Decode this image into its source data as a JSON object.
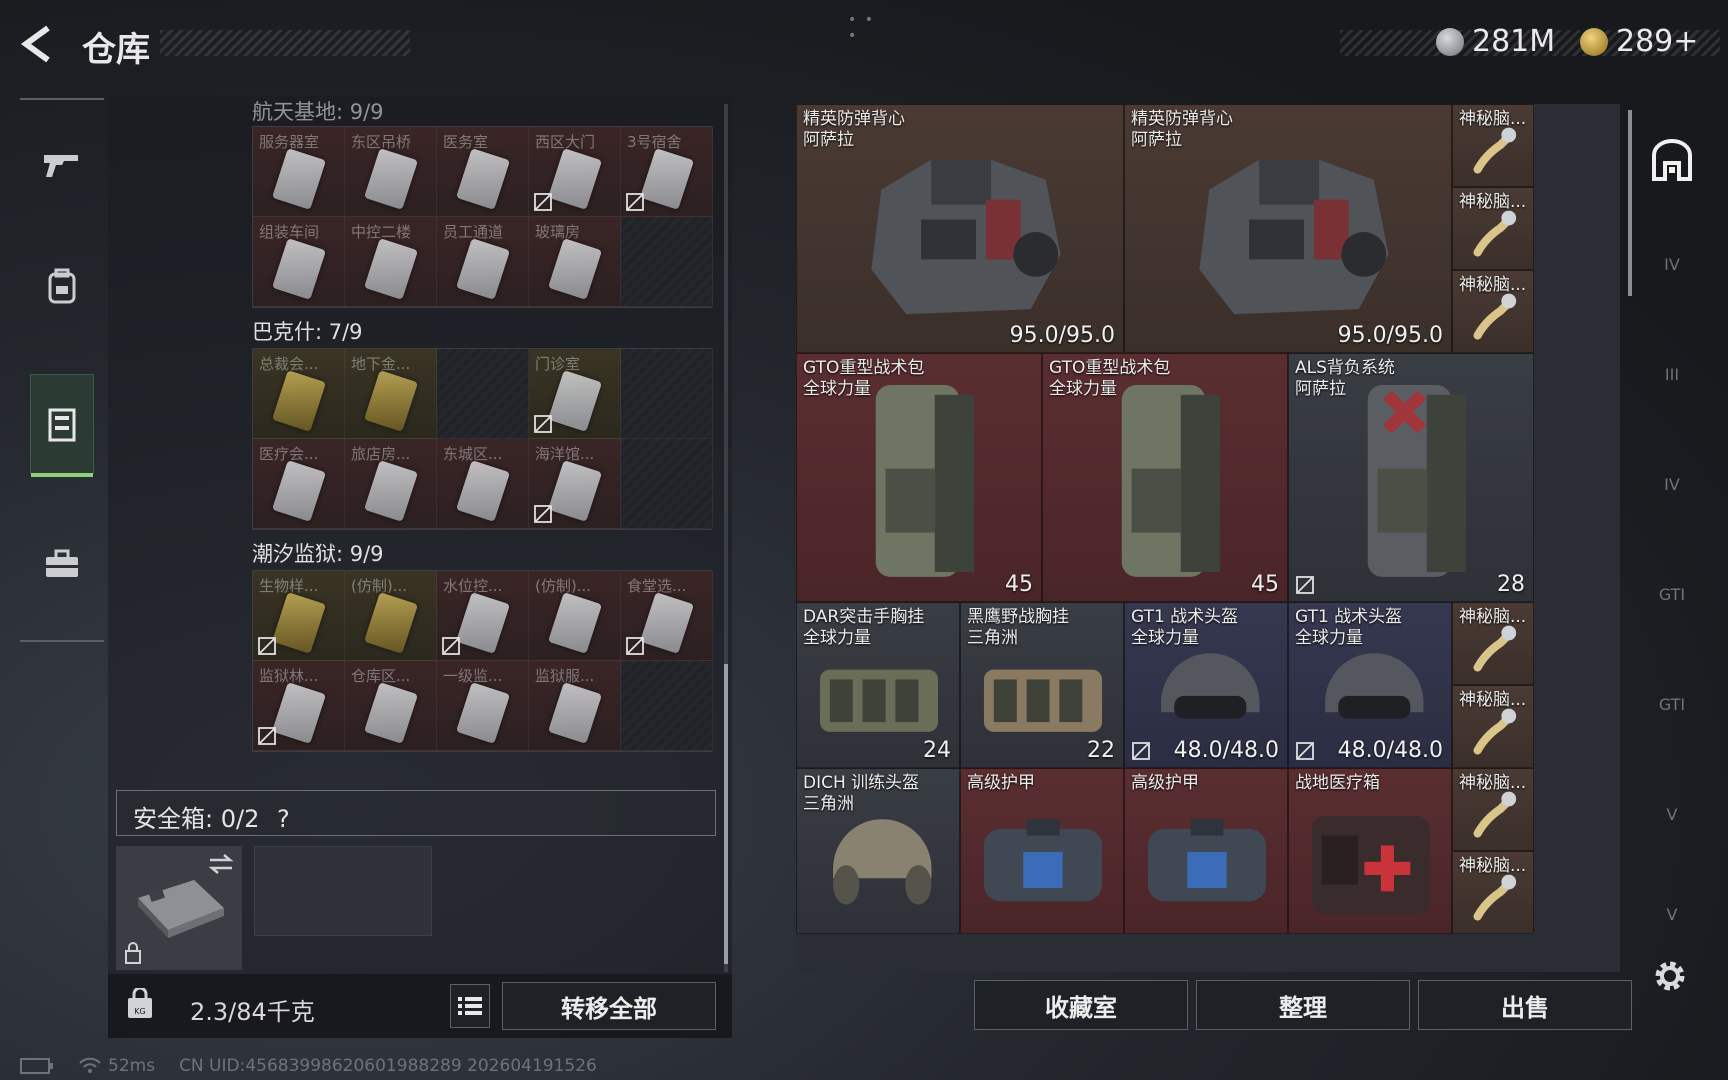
{
  "header": {
    "title": "仓库",
    "currency_silver": "281M",
    "currency_gold": "289+"
  },
  "left_rail": {
    "items": [
      "gun-icon",
      "backpack-icon",
      "locker-icon",
      "briefcase-icon"
    ],
    "active": "locker-icon"
  },
  "keys": {
    "top_map_label": "航天基地: 9/9",
    "top_cards": [
      {
        "name": "服务器室",
        "tint": "red",
        "nodrop": false
      },
      {
        "name": "东区吊桥",
        "tint": "red",
        "nodrop": false
      },
      {
        "name": "医务室",
        "tint": "red",
        "nodrop": false
      },
      {
        "name": "西区大门",
        "tint": "red",
        "nodrop": true
      },
      {
        "name": "3号宿舍",
        "tint": "red",
        "nodrop": true
      },
      {
        "name": "组装车间",
        "tint": "red",
        "nodrop": false
      },
      {
        "name": "中控二楼",
        "tint": "red",
        "nodrop": false
      },
      {
        "name": "员工通道",
        "tint": "red",
        "nodrop": false
      },
      {
        "name": "玻璃房",
        "tint": "red",
        "nodrop": false
      },
      {
        "name": "",
        "tint": "empty",
        "nodrop": false
      }
    ],
    "bakshi_label": "巴克什: 7/9",
    "bakshi_cards": [
      {
        "name": "总裁会...",
        "tint": "yellow",
        "gold": true,
        "nodrop": false
      },
      {
        "name": "地下金...",
        "tint": "yellow",
        "gold": true,
        "nodrop": false
      },
      {
        "name": "",
        "tint": "empty",
        "nodrop": false
      },
      {
        "name": "门诊室",
        "tint": "yellow",
        "nodrop": true
      },
      {
        "name": "",
        "tint": "empty",
        "nodrop": false
      },
      {
        "name": "医疗会...",
        "tint": "red",
        "nodrop": false
      },
      {
        "name": "旅店房...",
        "tint": "red",
        "nodrop": false
      },
      {
        "name": "东城区...",
        "tint": "red",
        "nodrop": false
      },
      {
        "name": "海洋馆...",
        "tint": "red",
        "nodrop": true
      },
      {
        "name": "",
        "tint": "empty",
        "nodrop": false
      }
    ],
    "prison_label": "潮汐监狱: 9/9",
    "prison_cards": [
      {
        "name": "生物样...",
        "tint": "yellow",
        "gold": true,
        "nodrop": true
      },
      {
        "name": "(仿制)...",
        "tint": "yellow",
        "gold": true,
        "nodrop": false
      },
      {
        "name": "水位控...",
        "tint": "red",
        "nodrop": true
      },
      {
        "name": "(仿制)...",
        "tint": "red",
        "nodrop": false
      },
      {
        "name": "食堂选...",
        "tint": "red",
        "nodrop": true
      },
      {
        "name": "监狱林...",
        "tint": "red",
        "nodrop": true
      },
      {
        "name": "仓库区...",
        "tint": "red",
        "nodrop": false
      },
      {
        "name": "一级监...",
        "tint": "red",
        "nodrop": false
      },
      {
        "name": "监狱服...",
        "tint": "red",
        "nodrop": false
      },
      {
        "name": "",
        "tint": "empty",
        "nodrop": false
      }
    ]
  },
  "safe": {
    "label": "安全箱: 0/2",
    "help": "?"
  },
  "bottom_left": {
    "weight": "2.3/84千克",
    "transfer_all": "转移全部"
  },
  "items": [
    {
      "name": "精英防弹背心\n阿萨拉",
      "value": "95.0/95.0",
      "tint": "brown",
      "kind": "vest"
    },
    {
      "name": "精英防弹背心\n阿萨拉",
      "value": "95.0/95.0",
      "tint": "brown",
      "kind": "vest"
    },
    {
      "name": "神秘脑...",
      "tint": "brown",
      "kind": "mystery"
    },
    {
      "name": "神秘脑...",
      "tint": "brown",
      "kind": "mystery"
    },
    {
      "name": "神秘脑...",
      "tint": "brown",
      "kind": "mystery"
    },
    {
      "name": "GTO重型战术包\n全球力量",
      "value": "45",
      "tint": "red",
      "kind": "pack"
    },
    {
      "name": "GTO重型战术包\n全球力量",
      "value": "45",
      "tint": "red",
      "kind": "pack"
    },
    {
      "name": "ALS背负系统\n阿萨拉",
      "value": "28",
      "tint": "gray",
      "kind": "pack2"
    },
    {
      "name": "DAR突击手胸挂\n全球力量",
      "value": "24",
      "tint": "gray",
      "kind": "rig"
    },
    {
      "name": "黑鹰野战胸挂\n三角洲",
      "value": "22",
      "tint": "gray",
      "kind": "rig2"
    },
    {
      "name": "GT1 战术头盔\n全球力量",
      "value": "48.0/48.0",
      "tint": "blue",
      "kind": "helmet"
    },
    {
      "name": "GT1 战术头盔\n全球力量",
      "value": "48.0/48.0",
      "tint": "blue",
      "kind": "helmet"
    },
    {
      "name": "神秘脑...",
      "tint": "brown",
      "kind": "mystery"
    },
    {
      "name": "神秘脑...",
      "tint": "brown",
      "kind": "mystery"
    },
    {
      "name": "DICH 训练头盔\n三角洲",
      "tint": "gray",
      "kind": "helmet2"
    },
    {
      "name": "高级护甲",
      "tint": "red",
      "kind": "armor"
    },
    {
      "name": "高级护甲",
      "tint": "red",
      "kind": "armor"
    },
    {
      "name": "战地医疗箱",
      "tint": "red",
      "kind": "medkit"
    },
    {
      "name": "神秘脑...",
      "tint": "brown",
      "kind": "mystery"
    },
    {
      "name": "神秘脑...",
      "tint": "brown",
      "kind": "mystery"
    }
  ],
  "bottom_right": {
    "collection": "收藏室",
    "organize": "整理",
    "sell": "出售"
  },
  "right_rail": [
    "base-icon",
    "IV",
    "III",
    "IV",
    "GTI",
    "GTI",
    "V",
    "V"
  ],
  "footer": {
    "ping": "52ms",
    "uid": "CN UID:456839986206019882​89 202604191526"
  }
}
